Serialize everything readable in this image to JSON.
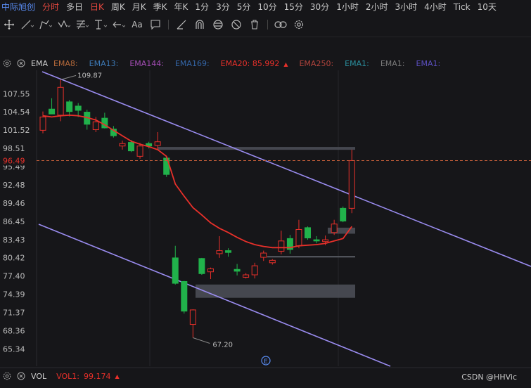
{
  "topbar": {
    "stock_name": "中际旭创",
    "timeframes": [
      "分时",
      "多日",
      "日K",
      "周K",
      "月K",
      "季K",
      "年K",
      "1分",
      "3分",
      "5分",
      "10分",
      "15分",
      "30分",
      "1小时",
      "2小时",
      "3小时",
      "4小时",
      "Tick",
      "10天"
    ],
    "active_timeframe": "日K",
    "highlighted_timeframe": "分时"
  },
  "toolbar": {
    "text_tool_label": "Aa",
    "icons": [
      "crosshair-icon",
      "line-icon",
      "pen-icon",
      "pattern-icon",
      "fib-icon",
      "range-icon",
      "arrow-icon",
      "text-icon",
      "comment-icon",
      "ruler-icon",
      "magnet-icon",
      "lock-icon",
      "hide-icon",
      "delete-icon",
      "link-icon",
      "settings-icon"
    ]
  },
  "indicator_legend": {
    "name": "EMA",
    "items": [
      {
        "label": "EMA8:",
        "value": "",
        "color": "#b5693a"
      },
      {
        "label": "EMA13:",
        "value": "",
        "color": "#3c78b4"
      },
      {
        "label": "EMA144:",
        "value": "",
        "color": "#a34db4"
      },
      {
        "label": "EMA169:",
        "value": "",
        "color": "#3466a8"
      },
      {
        "label": "EMA20:",
        "value": "85.992",
        "color": "#e8302a",
        "arrow": "▲"
      },
      {
        "label": "EMA250:",
        "value": "",
        "color": "#b0433c"
      },
      {
        "label": "EMA1:",
        "value": "",
        "color": "#2a8d9c"
      },
      {
        "label": "EMA1:",
        "value": "",
        "color": "#7a7a7a"
      },
      {
        "label": "EMA1:",
        "value": "",
        "color": "#5b4fbf"
      }
    ]
  },
  "volume_legend": {
    "name": "VOL",
    "label": "VOL1:",
    "value": "99.174",
    "arrow": "▲",
    "color": "#e8302a"
  },
  "price_axis": {
    "ticks": [
      "107.55",
      "104.54",
      "101.52",
      "98.51",
      "95.49",
      "92.48",
      "89.46",
      "86.45",
      "83.43",
      "80.42",
      "77.40",
      "74.39",
      "71.37",
      "68.36",
      "65.34"
    ],
    "current_price": "96.49"
  },
  "annotations": {
    "high_label": "109.87",
    "low_label": "67.20"
  },
  "chart_data": {
    "type": "candlestick",
    "title": "",
    "ylim": [
      63.5,
      110.5
    ],
    "y_ticks": [
      107.55,
      104.54,
      101.52,
      98.51,
      95.49,
      92.48,
      89.46,
      86.45,
      83.43,
      80.42,
      77.4,
      74.39,
      71.37,
      68.36,
      65.34
    ],
    "current_price": 96.49,
    "high_marker": 109.87,
    "low_marker": 67.2,
    "up_color": "#e8302a",
    "down_color": "#21b24b",
    "candles": [
      {
        "o": 101.5,
        "h": 104.6,
        "l": 101.0,
        "c": 103.7
      },
      {
        "o": 105.0,
        "h": 106.8,
        "l": 104.2,
        "c": 104.2
      },
      {
        "o": 104.0,
        "h": 109.87,
        "l": 103.0,
        "c": 108.6
      },
      {
        "o": 106.2,
        "h": 106.5,
        "l": 103.8,
        "c": 104.6
      },
      {
        "o": 105.5,
        "h": 106.0,
        "l": 103.7,
        "c": 104.8
      },
      {
        "o": 104.5,
        "h": 104.9,
        "l": 101.6,
        "c": 102.5
      },
      {
        "o": 101.6,
        "h": 103.7,
        "l": 101.2,
        "c": 102.9
      },
      {
        "o": 103.5,
        "h": 104.4,
        "l": 101.8,
        "c": 101.9
      },
      {
        "o": 101.7,
        "h": 102.2,
        "l": 100.3,
        "c": 100.6
      },
      {
        "o": 98.9,
        "h": 99.8,
        "l": 98.3,
        "c": 99.3
      },
      {
        "o": 99.5,
        "h": 99.9,
        "l": 97.9,
        "c": 98.1
      },
      {
        "o": 97.2,
        "h": 99.4,
        "l": 96.8,
        "c": 98.9
      },
      {
        "o": 99.3,
        "h": 99.6,
        "l": 98.5,
        "c": 98.9
      },
      {
        "o": 99.0,
        "h": 101.2,
        "l": 98.3,
        "c": 99.6
      },
      {
        "o": 96.9,
        "h": 97.1,
        "l": 93.8,
        "c": 94.2
      },
      {
        "o": 80.4,
        "h": 82.4,
        "l": 76.0,
        "c": 76.2
      },
      {
        "o": 76.5,
        "h": 76.6,
        "l": 71.2,
        "c": 71.6
      },
      {
        "o": 69.4,
        "h": 71.9,
        "l": 67.2,
        "c": 71.8
      },
      {
        "o": 80.3,
        "h": 80.4,
        "l": 77.6,
        "c": 77.8
      },
      {
        "o": 78.1,
        "h": 78.8,
        "l": 76.9,
        "c": 78.6
      },
      {
        "o": 81.1,
        "h": 84.0,
        "l": 80.4,
        "c": 81.6
      },
      {
        "o": 81.6,
        "h": 82.0,
        "l": 80.6,
        "c": 81.3
      },
      {
        "o": 78.5,
        "h": 79.4,
        "l": 77.5,
        "c": 78.2
      },
      {
        "o": 77.2,
        "h": 77.9,
        "l": 77.0,
        "c": 77.6
      },
      {
        "o": 77.6,
        "h": 79.6,
        "l": 77.0,
        "c": 79.1
      },
      {
        "o": 80.5,
        "h": 81.6,
        "l": 79.9,
        "c": 81.2
      },
      {
        "o": 79.6,
        "h": 80.2,
        "l": 79.3,
        "c": 80.0
      },
      {
        "o": 81.5,
        "h": 84.9,
        "l": 81.0,
        "c": 83.2
      },
      {
        "o": 83.6,
        "h": 84.2,
        "l": 81.1,
        "c": 81.8
      },
      {
        "o": 82.4,
        "h": 86.7,
        "l": 82.0,
        "c": 85.1
      },
      {
        "o": 85.4,
        "h": 85.6,
        "l": 83.4,
        "c": 83.7
      },
      {
        "o": 83.4,
        "h": 84.0,
        "l": 82.8,
        "c": 83.2
      },
      {
        "o": 83.1,
        "h": 84.1,
        "l": 82.5,
        "c": 83.4
      },
      {
        "o": 84.6,
        "h": 86.7,
        "l": 84.2,
        "c": 86.0
      },
      {
        "o": 88.6,
        "h": 88.9,
        "l": 86.3,
        "c": 86.5
      },
      {
        "o": 88.6,
        "h": 98.3,
        "l": 87.8,
        "c": 96.49
      }
    ],
    "ema20": [
      103.9,
      103.7,
      103.9,
      104.0,
      103.9,
      103.6,
      103.2,
      102.4,
      101.5,
      100.6,
      99.7,
      99.2,
      98.8,
      98.3,
      97.2,
      92.6,
      90.6,
      88.7,
      87.5,
      86.2,
      85.3,
      84.6,
      83.8,
      83.1,
      82.6,
      82.3,
      82.1,
      82.1,
      82.1,
      82.4,
      82.5,
      82.6,
      82.8,
      83.2,
      83.6,
      85.6
    ]
  }
}
